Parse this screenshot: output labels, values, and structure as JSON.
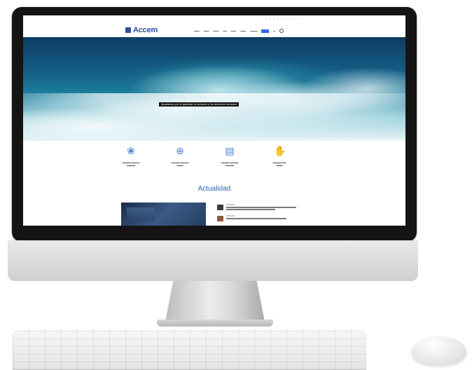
{
  "site": {
    "logo_text": "Accem"
  },
  "hero": {
    "caption": "Apostamos por la igualdad, la inclusión y los derechos humanos"
  },
  "section": {
    "title": "Actualidad"
  },
  "icons": {
    "brand": "accem-logo-mark",
    "feature_1": "people-icon",
    "feature_2": "globe-hands-icon",
    "feature_3": "document-icon",
    "feature_4": "handshake-icon",
    "nav_search": "search-icon"
  },
  "colors": {
    "brand_blue": "#2d4e9c",
    "accent_blue": "#2f62b8",
    "cta_blue": "#2d6cdf"
  }
}
